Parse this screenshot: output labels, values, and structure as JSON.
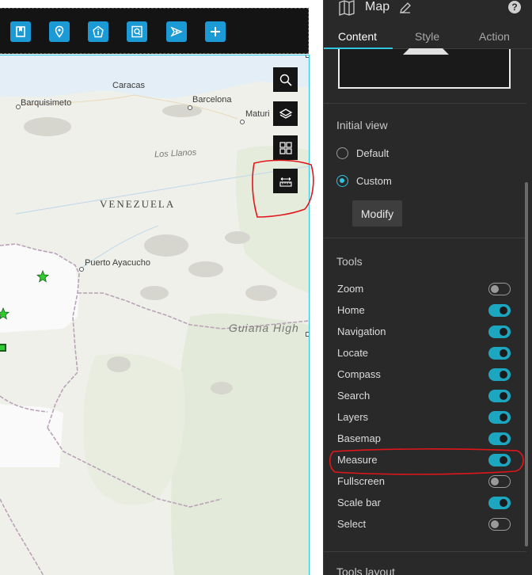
{
  "toolbar": {
    "icons": [
      "bookmark-icon",
      "location-pin-icon",
      "info-icon",
      "query-icon",
      "share-icon",
      "add-icon"
    ],
    "accent": "#1b9ad6"
  },
  "map": {
    "labels": {
      "caracas": "Caracas",
      "barquisimeto": "Barquisimeto",
      "barcelona": "Barcelona",
      "maturin": "Maturi",
      "los_llanos": "Los Llanos",
      "country": "VENEZUELA",
      "puerto_ayacucho": "Puerto Ayacucho",
      "guiana": "Guiana High"
    },
    "tools": [
      "search-icon",
      "layers-icon",
      "basemap-gallery-icon",
      "measure-icon"
    ]
  },
  "panel": {
    "title": "Map",
    "tabs": [
      "Content",
      "Style",
      "Action"
    ],
    "active_tab": "Content",
    "initial_view": {
      "title": "Initial view",
      "options": [
        "Default",
        "Custom"
      ],
      "selected": "Custom",
      "modify_label": "Modify"
    },
    "tools": {
      "title": "Tools",
      "items": [
        {
          "label": "Zoom",
          "on": false
        },
        {
          "label": "Home",
          "on": true
        },
        {
          "label": "Navigation",
          "on": true
        },
        {
          "label": "Locate",
          "on": true
        },
        {
          "label": "Compass",
          "on": true
        },
        {
          "label": "Search",
          "on": true
        },
        {
          "label": "Layers",
          "on": true
        },
        {
          "label": "Basemap",
          "on": true
        },
        {
          "label": "Measure",
          "on": true
        },
        {
          "label": "Fullscreen",
          "on": false
        },
        {
          "label": "Scale bar",
          "on": true
        },
        {
          "label": "Select",
          "on": false
        }
      ]
    },
    "tools_layout": "Tools layout",
    "accent": "#2ec6e0"
  }
}
